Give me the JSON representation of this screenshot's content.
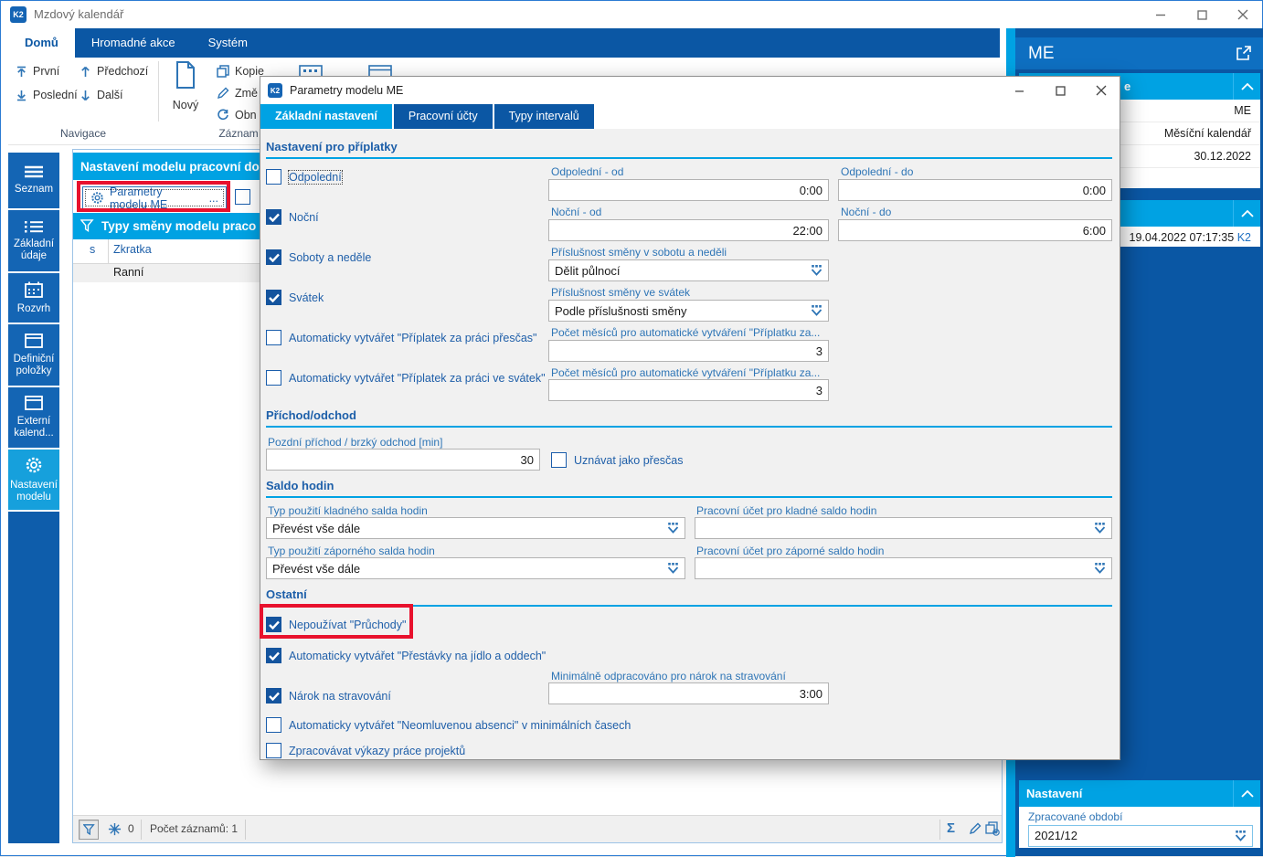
{
  "app": {
    "title": "Mzdový kalendář",
    "logo": "K2"
  },
  "ribbon": {
    "tabs": [
      {
        "label": "Domů"
      },
      {
        "label": "Hromadné akce"
      },
      {
        "label": "Systém"
      }
    ],
    "nav": {
      "first": "První",
      "last": "Poslední",
      "prev": "Předchozí",
      "next": "Další"
    },
    "record": {
      "new": "Nový",
      "copy": "Kopie",
      "change": "Změ",
      "refresh": "Obn"
    },
    "groups": {
      "navigation": "Navigace",
      "record": "Záznam"
    }
  },
  "sidebar": {
    "items": [
      {
        "label": "Seznam"
      },
      {
        "label": "Základní údaje"
      },
      {
        "label": "Rozvrh"
      },
      {
        "label": "Definiční položky"
      },
      {
        "label": "Externí kalend..."
      },
      {
        "label": "Nastavení modelu"
      }
    ]
  },
  "main": {
    "panel_title": "Nastavení modelu pracovní dob",
    "params_button": {
      "label": "Parametry modelu ME",
      "more": "..."
    },
    "shifts_title": "Typy směny modelu praco",
    "table": {
      "col_s": "s",
      "col_zkratka": "Zkratka",
      "row1": "Ranní"
    },
    "status": {
      "frozen": "0",
      "records": "Počet záznamů: 1",
      "sum": "Σ"
    }
  },
  "dialog": {
    "title": "Parametry modelu ME",
    "tabs": {
      "t1": "Základní nastavení",
      "t2": "Pracovní účty",
      "t3": "Typy intervalů"
    },
    "sections": {
      "s1": "Nastavení pro příplatky",
      "s2": "Příchod/odchod",
      "s3": "Saldo hodin",
      "s4": "Ostatní"
    },
    "cb": {
      "odpoledni": "Odpolední",
      "nocni": "Noční",
      "soboty": "Soboty a neděle",
      "svatek": "Svátek",
      "prescas": "Automaticky vytvářet \"Příplatek za práci přesčas\"",
      "vesvatek": "Automaticky vytvářet \"Příplatek za práci ve svátek\"",
      "uznavat": "Uznávat jako přesčas",
      "pruchody": "Nepoužívat \"Průchody\"",
      "prestavky": "Automaticky vytvářet \"Přestávky na jídlo a oddech\"",
      "narok": "Nárok na stravování",
      "absence": "Automaticky vytvářet \"Neomluvenou absenci\" v minimálních časech",
      "vykazy": "Zpracovávat výkazy práce projektů"
    },
    "fields": {
      "odp_od": {
        "label": "Odpolední - od",
        "value": "0:00"
      },
      "odp_do": {
        "label": "Odpolední - do",
        "value": "0:00"
      },
      "noc_od": {
        "label": "Noční - od",
        "value": "22:00"
      },
      "noc_do": {
        "label": "Noční - do",
        "value": "6:00"
      },
      "prislusnost_so_ne": {
        "label": "Příslušnost směny v sobotu a neděli",
        "value": "Dělit půlnocí"
      },
      "prislusnost_sv": {
        "label": "Příslušnost směny ve svátek",
        "value": "Podle příslušnosti směny"
      },
      "pocet1": {
        "label": "Počet měsíců pro automatické vytváření \"Příplatku za...",
        "value": "3"
      },
      "pocet2": {
        "label": "Počet měsíců pro automatické vytváření \"Příplatku za...",
        "value": "3"
      },
      "pozdni": {
        "label": "Pozdní příchod / brzký odchod [min]",
        "value": "30"
      },
      "typ_klad": {
        "label": "Typ použití kladného salda hodin",
        "value": "Převést vše dále"
      },
      "ucet_klad": {
        "label": "Pracovní účet pro kladné saldo hodin",
        "value": ""
      },
      "typ_zap": {
        "label": "Typ použití záporného salda hodin",
        "value": "Převést vše dále"
      },
      "ucet_zap": {
        "label": "Pracovní účet pro záporné saldo hodin",
        "value": ""
      },
      "minimalne": {
        "label": "Minimálně odpracováno pro nárok na stravování",
        "value": "3:00"
      }
    }
  },
  "right": {
    "record_title": "ME",
    "card1": {
      "header_fragment": "e",
      "rows": [
        "ME",
        "Měsíční kalendář",
        "30.12.2022"
      ]
    },
    "card2": {
      "timestamp": "19.04.2022 07:17:35",
      "user": "K2"
    },
    "card3": {
      "header": "Nastavení",
      "period_label": "Zpracované období",
      "period_value": "2021/12"
    }
  },
  "colors": {
    "accent_cyan": "#00a2e3",
    "navy": "#0b57a4",
    "sidebar_blue": "#1465b4",
    "active_item": "#16a0dc",
    "label_blue": "#2e75b6",
    "title_blue": "#1d5fa9",
    "red_annotation": "#e8112d",
    "panel_navy": "#0a57a4",
    "me_band": "#0e6fc1"
  }
}
